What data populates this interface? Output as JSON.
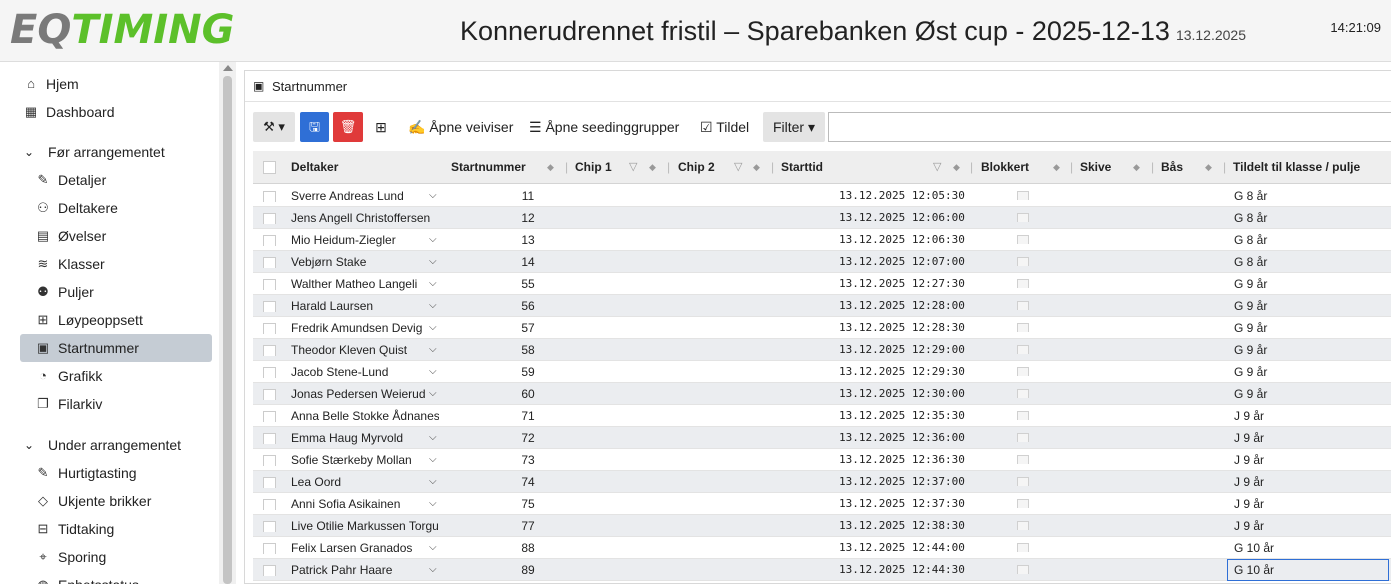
{
  "header": {
    "logo_eq": "EQ",
    "logo_timing": "TIMING",
    "title": "Konnerudrennet fristil – Sparebanken Øst cup - 2025-12-13",
    "date_small": "13.12.2025",
    "clock": "14:21:09"
  },
  "sidebar": {
    "top_items": [
      {
        "label": "Hjem",
        "icon": "home-icon"
      },
      {
        "label": "Dashboard",
        "icon": "dashboard-icon"
      }
    ],
    "group1": {
      "label": "Før arrangementet",
      "items": [
        {
          "label": "Detaljer",
          "icon": "edit-icon"
        },
        {
          "label": "Deltakere",
          "icon": "people-icon"
        },
        {
          "label": "Øvelser",
          "icon": "calendar-icon"
        },
        {
          "label": "Klasser",
          "icon": "layers-icon"
        },
        {
          "label": "Puljer",
          "icon": "group-icon"
        },
        {
          "label": "Løypeoppsett",
          "icon": "course-icon"
        },
        {
          "label": "Startnummer",
          "icon": "bib-icon"
        },
        {
          "label": "Grafikk",
          "icon": "palette-icon"
        },
        {
          "label": "Filarkiv",
          "icon": "file-icon"
        }
      ]
    },
    "group2": {
      "label": "Under arrangementet",
      "items": [
        {
          "label": "Hurtigtasting",
          "icon": "quick-edit-icon"
        },
        {
          "label": "Ukjente brikker",
          "icon": "tag-icon"
        },
        {
          "label": "Tidtaking",
          "icon": "table-icon"
        },
        {
          "label": "Sporing",
          "icon": "map-icon"
        },
        {
          "label": "Enhetsstatus",
          "icon": "globe-icon"
        }
      ]
    }
  },
  "panel": {
    "title": "Startnummer"
  },
  "toolbar": {
    "open_wizard": "Åpne veiviser",
    "open_seeding": "Åpne seedinggrupper",
    "assign": "Tildel",
    "filter": "Filter"
  },
  "table": {
    "columns": {
      "participant": "Deltaker",
      "bib": "Startnummer",
      "chip1": "Chip 1",
      "chip2": "Chip 2",
      "start_time": "Starttid",
      "blocked": "Blokkert",
      "target": "Skive",
      "stall": "Bås",
      "assigned_class": "Tildelt til klasse / pulje"
    },
    "rows": [
      {
        "name": "Sverre Andreas Lund",
        "bib": "11",
        "time": "13.12.2025 12:05:30",
        "cls": "G 8 år",
        "chev": true
      },
      {
        "name": "Jens Angell Christoffersen",
        "bib": "12",
        "time": "13.12.2025 12:06:00",
        "cls": "G 8 år",
        "chev": false
      },
      {
        "name": "Mio Heidum-Ziegler",
        "bib": "13",
        "time": "13.12.2025 12:06:30",
        "cls": "G 8 år",
        "chev": true
      },
      {
        "name": "Vebjørn Stake",
        "bib": "14",
        "time": "13.12.2025 12:07:00",
        "cls": "G 8 år",
        "chev": true
      },
      {
        "name": "Walther Matheo Langeli",
        "bib": "55",
        "time": "13.12.2025 12:27:30",
        "cls": "G 9 år",
        "chev": true
      },
      {
        "name": "Harald Laursen",
        "bib": "56",
        "time": "13.12.2025 12:28:00",
        "cls": "G 9 år",
        "chev": true
      },
      {
        "name": "Fredrik Amundsen Devig",
        "bib": "57",
        "time": "13.12.2025 12:28:30",
        "cls": "G 9 år",
        "chev": true
      },
      {
        "name": "Theodor Kleven Quist",
        "bib": "58",
        "time": "13.12.2025 12:29:00",
        "cls": "G 9 år",
        "chev": true
      },
      {
        "name": "Jacob Stene-Lund",
        "bib": "59",
        "time": "13.12.2025 12:29:30",
        "cls": "G 9 år",
        "chev": true
      },
      {
        "name": "Jonas Pedersen Weierud",
        "bib": "60",
        "time": "13.12.2025 12:30:00",
        "cls": "G 9 år",
        "chev": true
      },
      {
        "name": "Anna Belle Stokke Ådnanes",
        "bib": "71",
        "time": "13.12.2025 12:35:30",
        "cls": "J 9 år",
        "chev": false
      },
      {
        "name": "Emma Haug Myrvold",
        "bib": "72",
        "time": "13.12.2025 12:36:00",
        "cls": "J 9 år",
        "chev": true
      },
      {
        "name": "Sofie Stærkeby Mollan",
        "bib": "73",
        "time": "13.12.2025 12:36:30",
        "cls": "J 9 år",
        "chev": true
      },
      {
        "name": "Lea Oord",
        "bib": "74",
        "time": "13.12.2025 12:37:00",
        "cls": "J 9 år",
        "chev": true
      },
      {
        "name": "Anni Sofia Asikainen",
        "bib": "75",
        "time": "13.12.2025 12:37:30",
        "cls": "J 9 år",
        "chev": true
      },
      {
        "name": "Live Otilie Markussen Torgu",
        "bib": "77",
        "time": "13.12.2025 12:38:30",
        "cls": "J 9 år",
        "chev": false
      },
      {
        "name": "Felix Larsen Granados",
        "bib": "88",
        "time": "13.12.2025 12:44:00",
        "cls": "G 10 år",
        "chev": true
      },
      {
        "name": "Patrick Pahr Haare",
        "bib": "89",
        "time": "13.12.2025 12:44:30",
        "cls": "G 10 år",
        "chev": true
      }
    ]
  },
  "colors": {
    "accent_blue": "#2f6fd6",
    "danger_red": "#e03a3a",
    "logo_green": "#5cc02a",
    "active_nav": "#c5ccd4"
  }
}
